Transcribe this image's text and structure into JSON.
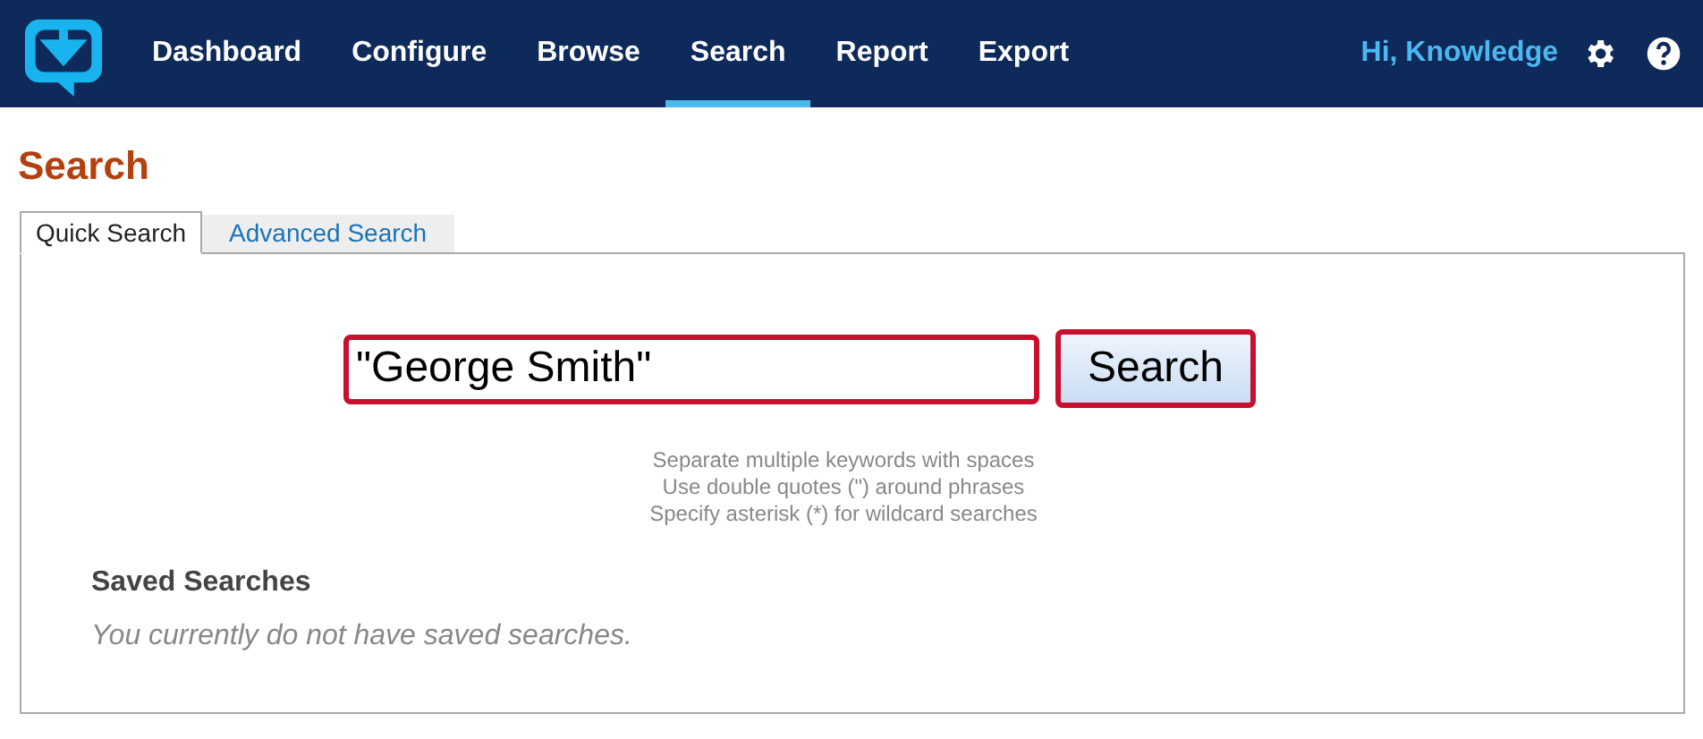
{
  "nav": {
    "items": [
      {
        "label": "Dashboard",
        "selected": false
      },
      {
        "label": "Configure",
        "selected": false
      },
      {
        "label": "Browse",
        "selected": false
      },
      {
        "label": "Search",
        "selected": true
      },
      {
        "label": "Report",
        "selected": false
      },
      {
        "label": "Export",
        "selected": false
      }
    ],
    "greeting": "Hi, Knowledge"
  },
  "page_title": "Search",
  "tabs": [
    {
      "label": "Quick Search",
      "selected": true
    },
    {
      "label": "Advanced Search",
      "selected": false
    }
  ],
  "search": {
    "value": "\"George Smith\"",
    "button": "Search"
  },
  "hints": [
    "Separate multiple keywords with spaces",
    "Use double quotes (\") around phrases",
    "Specify asterisk (*) for wildcard searches"
  ],
  "saved_searches": {
    "title": "Saved Searches",
    "empty_message": "You currently do not have saved searches."
  }
}
